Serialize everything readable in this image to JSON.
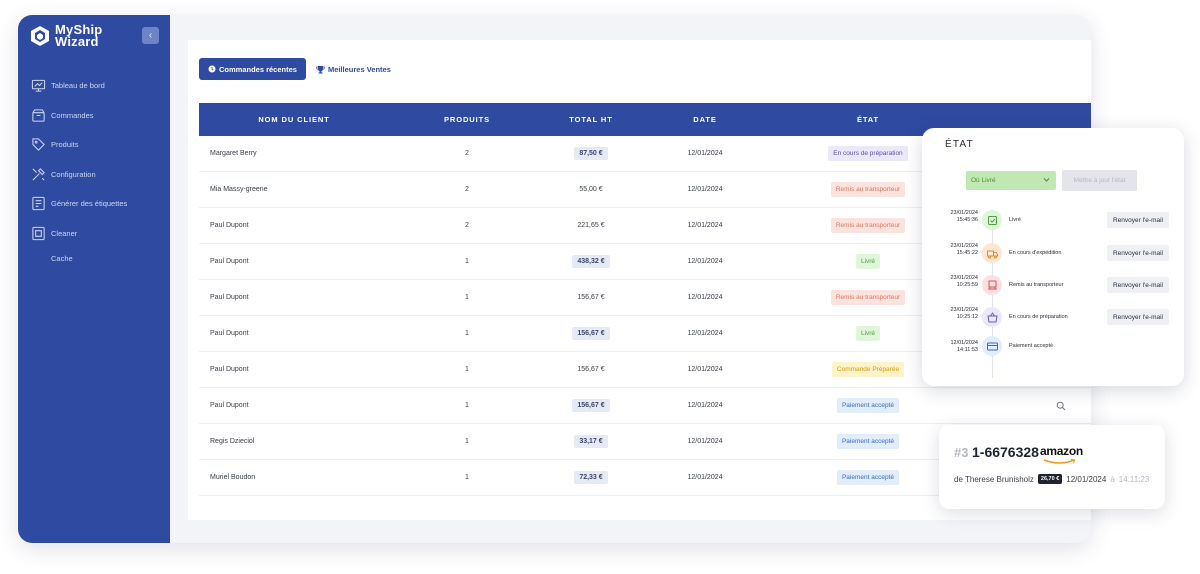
{
  "app": {
    "logo_line1": "MyShip",
    "logo_line2": "Wizard",
    "collapse_icon": "chevron-left-icon"
  },
  "sidebar": {
    "items": [
      {
        "label": "Tableau de bord",
        "icon": "dashboard-icon"
      },
      {
        "label": "Commandes",
        "icon": "box-icon"
      },
      {
        "label": "Produits",
        "icon": "tag-icon"
      },
      {
        "label": "Configuration",
        "icon": "tools-icon"
      },
      {
        "label": "Générer des étiquettes",
        "icon": "label-printer-icon"
      },
      {
        "label": "Cleaner",
        "icon": "cleaner-icon"
      }
    ],
    "sub_item": "Cache"
  },
  "tabs": {
    "active": "Commandes récentes",
    "other": "Meilleures Ventes"
  },
  "table": {
    "headers": {
      "name": "NOM DU CLIENT",
      "products": "PRODUITS",
      "total": "TOTAL HT",
      "date": "DATE",
      "state": "ÉTAT"
    },
    "rows": [
      {
        "name": "Margaret Berry",
        "products": "2",
        "total": "87,50 €",
        "highlight": true,
        "date": "12/01/2024",
        "state": "En cours de préparation",
        "state_type": "prep"
      },
      {
        "name": "Mia Massy-greene",
        "products": "2",
        "total": "55,00 €",
        "highlight": false,
        "date": "12/01/2024",
        "state": "Remis au transporteur",
        "state_type": "remis"
      },
      {
        "name": "Paul Dupont",
        "products": "2",
        "total": "221,65 €",
        "highlight": false,
        "date": "12/01/2024",
        "state": "Remis au transporteur",
        "state_type": "remis"
      },
      {
        "name": "Paul Dupont",
        "products": "1",
        "total": "438,32 €",
        "highlight": true,
        "date": "12/01/2024",
        "state": "Livré",
        "state_type": "livre"
      },
      {
        "name": "Paul Dupont",
        "products": "1",
        "total": "156,67 €",
        "highlight": false,
        "date": "12/01/2024",
        "state": "Remis au transporteur",
        "state_type": "remis"
      },
      {
        "name": "Paul Dupont",
        "products": "1",
        "total": "156,67 €",
        "highlight": true,
        "date": "12/01/2024",
        "state": "Livré",
        "state_type": "livre"
      },
      {
        "name": "Paul Dupont",
        "products": "1",
        "total": "156,67 €",
        "highlight": false,
        "date": "12/01/2024",
        "state": "Commande Préparée",
        "state_type": "cmd"
      },
      {
        "name": "Paul Dupont",
        "products": "1",
        "total": "156,67 €",
        "highlight": true,
        "date": "12/01/2024",
        "state": "Paiement accepté",
        "state_type": "pay"
      },
      {
        "name": "Regis Dzieciol",
        "products": "1",
        "total": "33,17 €",
        "highlight": true,
        "date": "12/01/2024",
        "state": "Paiement accepté",
        "state_type": "pay"
      },
      {
        "name": "Muriel Boudon",
        "products": "1",
        "total": "72,33 €",
        "highlight": true,
        "date": "12/01/2024",
        "state": "Paiement accepté",
        "state_type": "pay"
      }
    ]
  },
  "etat": {
    "title": "ÉTAT",
    "select_value": "Où Livré",
    "update_button": "Mettre à jour l'état",
    "events": [
      {
        "date": "23/01/2024",
        "time": "15:45:36",
        "label": "Livré",
        "icon": "livre-icon",
        "color": "#dff6d8",
        "stroke": "#4ba143",
        "button": "Renvoyer l'e-mail"
      },
      {
        "date": "23/01/2024",
        "time": "15:45:22",
        "label": "En cours d'expédition",
        "icon": "truck-icon",
        "color": "#fde6d2",
        "stroke": "#e08a3a",
        "button": "Renvoyer l'e-mail"
      },
      {
        "date": "23/01/2024",
        "time": "10:25:59",
        "label": "Remis au transporteur",
        "icon": "handover-icon",
        "color": "#fde0e3",
        "stroke": "#d9534f",
        "button": "Renvoyer l'e-mail"
      },
      {
        "date": "23/01/2024",
        "time": "10:25:12",
        "label": "En cours de préparation",
        "icon": "basket-icon",
        "color": "#ece8fb",
        "stroke": "#6a5bc2",
        "button": "Renvoyer l'e-mail"
      },
      {
        "date": "12/01/2024 14:11:53",
        "time": "",
        "label": "Paiement accepté",
        "icon": "credit-card-icon",
        "color": "#e1edfb",
        "stroke": "#3b6cc0",
        "button": ""
      }
    ]
  },
  "order": {
    "prefix": "#3",
    "number": "1-6676328",
    "marketplace": "amazon",
    "customer": "de Therese Brunisholz",
    "amount": "26,70 €",
    "date": "12/01/2024",
    "at": "à",
    "time": "14:11:23"
  }
}
